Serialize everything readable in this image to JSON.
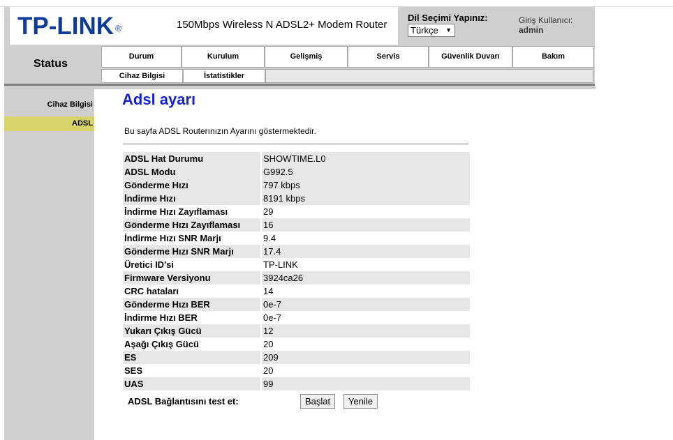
{
  "header": {
    "logo": "TP-LINK",
    "logo_mark": "®",
    "model": "150Mbps Wireless N ADSL2+ Modem Router",
    "language_label": "Dil Seçimi Yapınız:",
    "language_value": "Türkçe",
    "user_label": "Giriş Kullanıcı:",
    "user_name": "admin"
  },
  "status_title": "Status",
  "nav": {
    "tabs": [
      "Durum",
      "Kurulum",
      "Gelişmiş",
      "Servis",
      "Güvenlik Duvarı",
      "Bakım"
    ],
    "subtabs": [
      "Cihaz Bilgisi",
      "İstatistikler"
    ]
  },
  "sidebar": {
    "items": [
      {
        "label": "Cihaz Bilgisi"
      },
      {
        "label": "ADSL",
        "active": true
      }
    ]
  },
  "main": {
    "title": "Adsl ayarı",
    "description": "Bu sayfa ADSL Routerınızın Ayarını göstermektedir.",
    "rows": [
      {
        "label": "ADSL Hat Durumu",
        "value": "SHOWTIME.L0"
      },
      {
        "label": "ADSL Modu",
        "value": "G992.5"
      },
      {
        "label": "Gönderme Hızı",
        "value": "797 kbps"
      },
      {
        "label": "İndirme Hızı",
        "value": "8191 kbps"
      },
      {
        "label": "İndirme Hızı Zayıflaması",
        "value": "29"
      },
      {
        "label": "Gönderme Hızı Zayıflaması",
        "value": "16"
      },
      {
        "label": "İndirme Hızı SNR Marjı",
        "value": "9.4"
      },
      {
        "label": "Gönderme Hızı SNR Marjı",
        "value": "17.4"
      },
      {
        "label": "Üretici ID'si",
        "value": "TP-LINK"
      },
      {
        "label": "Firmware Versiyonu",
        "value": "3924ca26"
      },
      {
        "label": "CRC hataları",
        "value": "14"
      },
      {
        "label": "Gönderme Hızı BER",
        "value": "0e-7"
      },
      {
        "label": "İndirme Hızı BER",
        "value": "0e-7"
      },
      {
        "label": "Yukarı Çıkış Gücü",
        "value": "12"
      },
      {
        "label": "Aşağı Çıkış Gücü",
        "value": "20"
      },
      {
        "label": "ES",
        "value": "209"
      },
      {
        "label": "SES",
        "value": "20"
      },
      {
        "label": "UAS",
        "value": "99"
      }
    ],
    "test_label": "ADSL Bağlantısını test et:",
    "start_button": "Başlat",
    "refresh_button": "Yenile"
  },
  "colors": {
    "logo": "#0e3c98",
    "title": "#1622d6",
    "active_side": "#d6d468",
    "frame_gray": "#cfcfcf"
  }
}
